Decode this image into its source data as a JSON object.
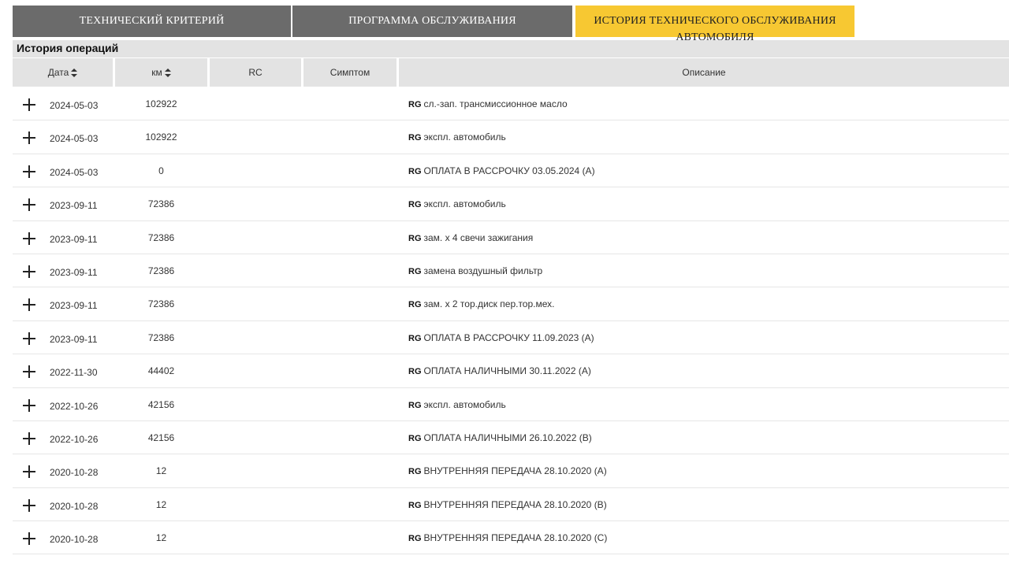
{
  "tabs": [
    {
      "label": "ТЕХНИЧЕСКИЙ КРИТЕРИЙ",
      "active": false
    },
    {
      "label": "ПРОГРАММА ОБСЛУЖИВАНИЯ",
      "active": false
    },
    {
      "label_line1": "ИСТОРИЯ ТЕХНИЧЕСКОГО ОБСЛУЖИВАНИЯ",
      "label_line2": "АВТОМОБИЛЯ",
      "active": true
    }
  ],
  "section_title": "История операций",
  "columns": {
    "date": "Дата",
    "km": "км",
    "rc": "RC",
    "symptom": "Симптом",
    "description": "Описание"
  },
  "rows": [
    {
      "date": "2024-05-03",
      "km": "102922",
      "rc": "",
      "symptom": "",
      "prefix": "RG",
      "desc": "сл.-зап. трансмиссионное масло"
    },
    {
      "date": "2024-05-03",
      "km": "102922",
      "rc": "",
      "symptom": "",
      "prefix": "RG",
      "desc": "экспл. автомобиль"
    },
    {
      "date": "2024-05-03",
      "km": "0",
      "rc": "",
      "symptom": "",
      "prefix": "RG",
      "desc": "ОПЛАТА В РАССРОЧКУ 03.05.2024 (A)"
    },
    {
      "date": "2023-09-11",
      "km": "72386",
      "rc": "",
      "symptom": "",
      "prefix": "RG",
      "desc": "экспл. автомобиль"
    },
    {
      "date": "2023-09-11",
      "km": "72386",
      "rc": "",
      "symptom": "",
      "prefix": "RG",
      "desc": "зам. x 4 свечи зажигания"
    },
    {
      "date": "2023-09-11",
      "km": "72386",
      "rc": "",
      "symptom": "",
      "prefix": "RG",
      "desc": "замена воздушный фильтр"
    },
    {
      "date": "2023-09-11",
      "km": "72386",
      "rc": "",
      "symptom": "",
      "prefix": "RG",
      "desc": "зам. x 2 тор.диск пер.тор.мех."
    },
    {
      "date": "2023-09-11",
      "km": "72386",
      "rc": "",
      "symptom": "",
      "prefix": "RG",
      "desc": "ОПЛАТА В РАССРОЧКУ 11.09.2023 (A)"
    },
    {
      "date": "2022-11-30",
      "km": "44402",
      "rc": "",
      "symptom": "",
      "prefix": "RG",
      "desc": "ОПЛАТА НАЛИЧНЫМИ 30.11.2022 (A)"
    },
    {
      "date": "2022-10-26",
      "km": "42156",
      "rc": "",
      "symptom": "",
      "prefix": "RG",
      "desc": "экспл. автомобиль"
    },
    {
      "date": "2022-10-26",
      "km": "42156",
      "rc": "",
      "symptom": "",
      "prefix": "RG",
      "desc": "ОПЛАТА НАЛИЧНЫМИ 26.10.2022 (B)"
    },
    {
      "date": "2020-10-28",
      "km": "12",
      "rc": "",
      "symptom": "",
      "prefix": "RG",
      "desc": "ВНУТРЕННЯЯ ПЕРЕДАЧА 28.10.2020 (A)"
    },
    {
      "date": "2020-10-28",
      "km": "12",
      "rc": "",
      "symptom": "",
      "prefix": "RG",
      "desc": "ВНУТРЕННЯЯ ПЕРЕДАЧА 28.10.2020 (B)"
    },
    {
      "date": "2020-10-28",
      "km": "12",
      "rc": "",
      "symptom": "",
      "prefix": "RG",
      "desc": "ВНУТРЕННЯЯ ПЕРЕДАЧА 28.10.2020 (C)"
    }
  ],
  "icons": {
    "expand": "plus-icon",
    "sort": "sort-icon"
  },
  "colors": {
    "tab_inactive": "#6b6b6b",
    "tab_active": "#f7c832",
    "header_bg": "#e3e3e3"
  }
}
